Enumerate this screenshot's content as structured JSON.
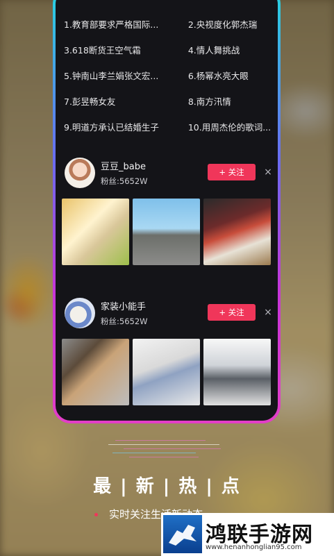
{
  "hotlist": [
    [
      "1.教育部要求严格国际...",
      "2.央视度化郭杰瑞"
    ],
    [
      "3.618断货王空气霜",
      "4.情人舞挑战"
    ],
    [
      "5.钟南山李兰娟张文宏...",
      "6.杨幂水亮大眼"
    ],
    [
      "7.彭昱畅女友",
      "8.南方汛情"
    ],
    [
      "9.明道方承认已结婚生子",
      "10.用周杰伦的歌词..."
    ]
  ],
  "users": [
    {
      "name": "豆豆_babe",
      "fans": "粉丝:5652W",
      "follow_label": "+ 关注",
      "close": "×"
    },
    {
      "name": "家装小能手",
      "fans": "粉丝:5652W",
      "follow_label": "+ 关注",
      "close": "×"
    }
  ],
  "headline": "最 | 新 | 热 | 点",
  "subtitle": "实时关注生活新动态",
  "watermark": {
    "title": "鸿联手游网",
    "url": "www.henanhonglian95.com"
  },
  "colors": {
    "accent": "#f0365a",
    "frame_top": "#25d6e0",
    "frame_bottom": "#e33ec8"
  }
}
